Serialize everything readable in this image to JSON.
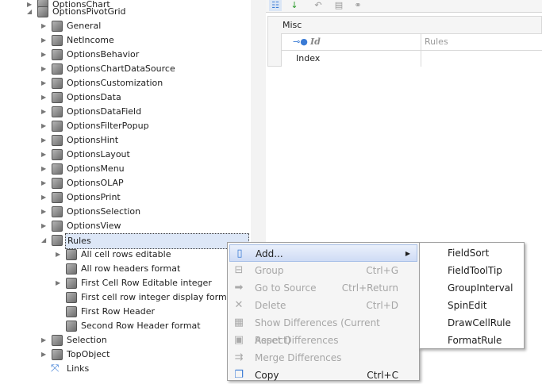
{
  "tree": {
    "top_partial": "OptionsChart",
    "root": "OptionsPivotGrid",
    "children": [
      "General",
      "NetIncome",
      "OptionsBehavior",
      "OptionsChartDataSource",
      "OptionsCustomization",
      "OptionsData",
      "OptionsDataField",
      "OptionsFilterPopup",
      "OptionsHint",
      "OptionsLayout",
      "OptionsMenu",
      "OptionsOLAP",
      "OptionsPrint",
      "OptionsSelection",
      "OptionsView"
    ],
    "rules": "Rules",
    "rule_children": [
      {
        "label": "All cell rows editable",
        "expandable": true
      },
      {
        "label": "All row headers format",
        "expandable": false
      },
      {
        "label": "First Cell Row Editable integer",
        "expandable": true
      },
      {
        "label": "First cell row integer display format",
        "expandable": false
      },
      {
        "label": "First Row Header",
        "expandable": false
      },
      {
        "label": "Second Row Header format",
        "expandable": false
      }
    ],
    "after": [
      "Selection",
      "TopObject"
    ],
    "links": "Links"
  },
  "property_grid": {
    "category": "Misc",
    "rows": [
      {
        "name": "Id",
        "value": "Rules"
      },
      {
        "name": "Index",
        "value": ""
      }
    ]
  },
  "context_menu": {
    "items": [
      {
        "label": "Add...",
        "shortcut": "",
        "enabled": true,
        "icon": "new-icon",
        "submenu": true
      },
      {
        "label": "Group",
        "shortcut": "Ctrl+G",
        "enabled": false,
        "icon": "group-icon"
      },
      {
        "label": "Go to Source",
        "shortcut": "Ctrl+Return",
        "enabled": false,
        "icon": "arrow-right-icon"
      },
      {
        "label": "Delete",
        "shortcut": "Ctrl+D",
        "enabled": false,
        "icon": "delete-icon"
      },
      {
        "label": "Show Differences (Current Aspect)",
        "shortcut": "",
        "enabled": false,
        "icon": "xml-diff-icon"
      },
      {
        "label": "Reset Differences",
        "shortcut": "",
        "enabled": false,
        "icon": "xml-reset-icon"
      },
      {
        "label": "Merge Differences",
        "shortcut": "",
        "enabled": false,
        "icon": "merge-icon"
      },
      {
        "label": "Copy",
        "shortcut": "Ctrl+C",
        "enabled": true,
        "icon": "copy-icon"
      }
    ],
    "submenu": [
      "FieldSort",
      "FieldToolTip",
      "GroupInterval",
      "SpinEdit",
      "DrawCellRule",
      "FormatRule"
    ]
  }
}
